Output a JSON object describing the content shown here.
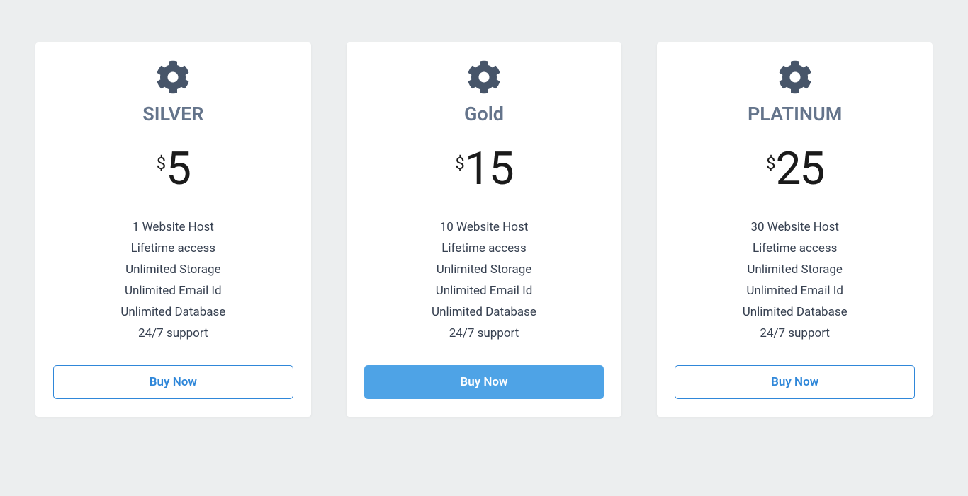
{
  "currency_symbol": "$",
  "common_features": {
    "lifetime": "Lifetime access",
    "storage": "Unlimited Storage",
    "email": "Unlimited Email Id",
    "database": "Unlimited Database",
    "support": "24/7 support"
  },
  "buy_label": "Buy Now",
  "plans": [
    {
      "name": "SILVER",
      "price": "5",
      "hosts": "1 Website Host",
      "button_style": "outline"
    },
    {
      "name": "Gold",
      "price": "15",
      "hosts": "10 Website Host",
      "button_style": "solid"
    },
    {
      "name": "PLATINUM",
      "price": "25",
      "hosts": "30 Website Host",
      "button_style": "outline"
    }
  ]
}
